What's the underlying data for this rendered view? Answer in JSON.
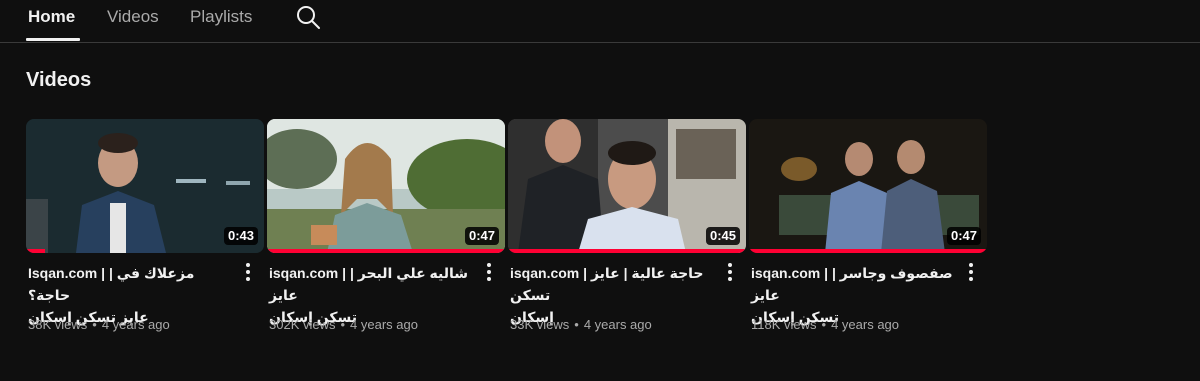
{
  "tabs": [
    {
      "label": "Home",
      "active": true
    },
    {
      "label": "Videos",
      "active": false
    },
    {
      "label": "Playlists",
      "active": false
    }
  ],
  "search_icon": "search-icon",
  "section": {
    "title": "Videos"
  },
  "videos": [
    {
      "title_line1": "Isqan.com | | مزعلاك في حاجة؟",
      "title_line2": "عايز تسكن إسكان",
      "duration": "0:43",
      "views": "38K views",
      "age": "4 years ago",
      "progress": 0.08
    },
    {
      "title_line1": "isqan.com | شاليه علي البحر | عايز",
      "title_line2": "تسكن إسكان",
      "duration": "0:47",
      "views": "302K views",
      "age": "4 years ago",
      "progress": 1.0
    },
    {
      "title_line1": "isqan.com | حاجة عالية | عايز تسكن",
      "title_line2": "إسكان",
      "duration": "0:45",
      "views": "33K views",
      "age": "4 years ago",
      "progress": 1.0
    },
    {
      "title_line1": "isqan.com | صفصوف وجاسر | عايز",
      "title_line2": "تسكن إسكان",
      "duration": "0:47",
      "views": "118K views",
      "age": "4 years ago",
      "progress": 1.0
    }
  ],
  "colors": {
    "background": "#0f0f0f",
    "progress": "#ff0033",
    "text_primary": "#f1f1f1",
    "text_secondary": "#aaaaaa"
  }
}
